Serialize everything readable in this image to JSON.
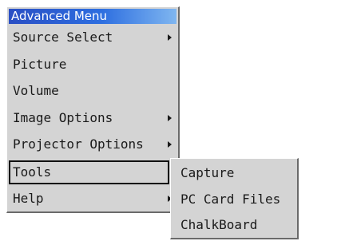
{
  "menu": {
    "title": "Advanced Menu",
    "items": [
      {
        "label": "Source Select",
        "has_submenu": true
      },
      {
        "label": "Picture",
        "has_submenu": false
      },
      {
        "label": "Volume",
        "has_submenu": false
      },
      {
        "label": "Image Options",
        "has_submenu": true
      },
      {
        "label": "Projector Options",
        "has_submenu": true
      },
      {
        "label": "Tools",
        "has_submenu": true,
        "selected": true
      },
      {
        "label": "Help",
        "has_submenu": true
      }
    ]
  },
  "submenu": {
    "parent": "Tools",
    "items": [
      {
        "label": "Capture"
      },
      {
        "label": "PC Card Files"
      },
      {
        "label": "ChalkBoard"
      }
    ]
  },
  "colors": {
    "title_gradient_start": "#2a4fc4",
    "title_gradient_end": "#7fb6f0",
    "menu_background": "#d4d4d4",
    "text": "#1a1a1a"
  },
  "icons": {
    "submenu_arrow": "right-triangle-arrow"
  }
}
